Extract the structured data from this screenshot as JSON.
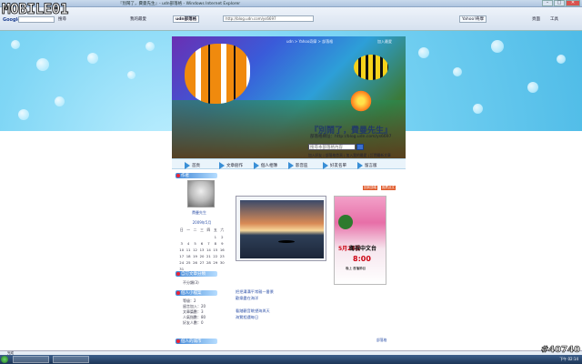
{
  "window": {
    "title": "『別鬧了，費曼先生』- udn部落格 - Windows Internet Explorer",
    "min": "–",
    "max": "□",
    "close": "✕"
  },
  "toolbar": {
    "google_label": "Google",
    "search_btn": "搜尋",
    "address": "http://blog.udn.com/ys6697",
    "tab_active": "『別鬧了，費曼先生』- udn部落格",
    "tab_yahoo": "Yahoo!奇摩",
    "bookmark_label": "我的最愛",
    "bookmark_add": "新增",
    "page_menu": "頁面",
    "tools_menu": "工具",
    "home_tab": "udn部落格",
    "tab_search": "搜尋"
  },
  "banner": {
    "header_links": "udn > Yahoo奇摩 > 部落格",
    "header_link2": "加入最愛",
    "title": "『別鬧了，費曼先生』",
    "url": "部落格網址：http://blog.udn.com/ys6697",
    "search_placeholder": "搜尋本部落格內容",
    "mini_links": "加入好友 | 部落格首頁 | 加入我的最愛 | 訂閱最新文章"
  },
  "nav": {
    "items": [
      "首頁",
      "文章創作",
      "個人相簿",
      "影音區",
      "好友名單",
      "留言版"
    ]
  },
  "sidebar": {
    "author_head": "作者",
    "avatar_name": "費曼先生",
    "calendar_title": "2009年5月",
    "weekdays": [
      "日",
      "一",
      "二",
      "三",
      "四",
      "五",
      "六"
    ],
    "days": [
      "",
      "",
      "",
      "",
      "",
      "1",
      "2",
      "3",
      "4",
      "5",
      "6",
      "7",
      "8",
      "9",
      "10",
      "11",
      "12",
      "13",
      "14",
      "15",
      "16",
      "17",
      "18",
      "19",
      "20",
      "21",
      "22",
      "23",
      "24",
      "25",
      "26",
      "27",
      "28",
      "29",
      "30",
      "31",
      "",
      "",
      "",
      "",
      "",
      ""
    ],
    "category_head": "自訂文章分類",
    "category_item": "不分類(3)",
    "stats_head": "個人小檔案",
    "stats": [
      "等級：2",
      "留言加入：20",
      "文章篇數：3",
      "人氣指數：80",
      "好友人數：0"
    ],
    "links_head": "個人的城市"
  },
  "content": {
    "btn_1": "回到頂端",
    "btn_2": "推薦此文",
    "ad": {
      "date": "5月24日",
      "venue": "衛視中文台",
      "time": "8:00",
      "small": "晚上 首播節目"
    },
    "post_links": [
      "把把溝溝平常親一番景",
      "歡樂盡在海洋",
      "看踏觀音眺望海與天",
      "海覽相遇每日"
    ],
    "footer_link": "部落格"
  },
  "statusbar": {
    "text": "完成"
  },
  "taskbar": {
    "clock": "下午 02:14"
  },
  "watermark": {
    "logo": "MOBILE01",
    "id": "#40740"
  }
}
